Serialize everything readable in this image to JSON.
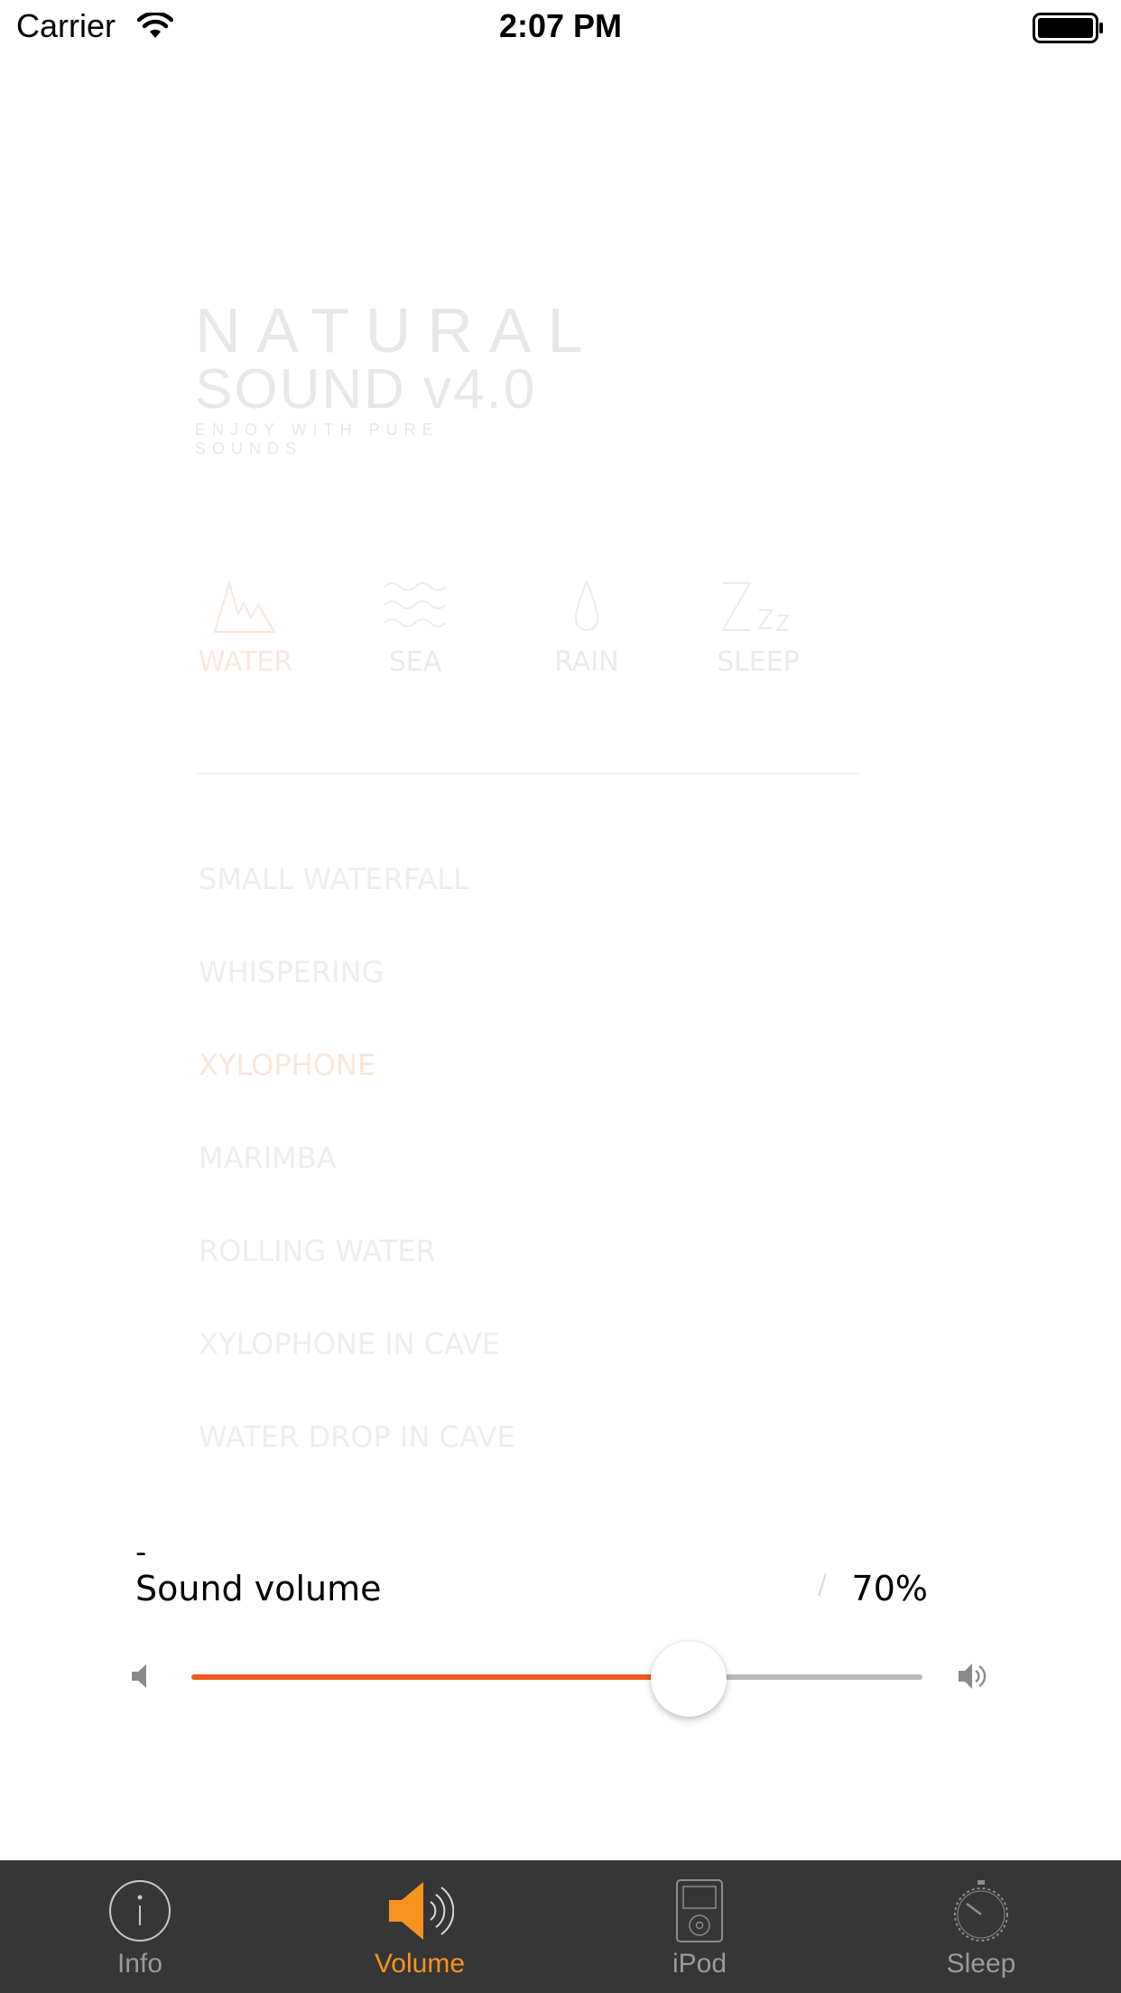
{
  "status_bar": {
    "carrier": "Carrier",
    "time": "2:07 PM"
  },
  "logo": {
    "line1": "NATURAL",
    "line2": "SOUND v4.0",
    "tagline": "ENJOY WITH PURE SOUNDS"
  },
  "categories": [
    {
      "label": "WATER",
      "icon": "mountain-icon",
      "active": true
    },
    {
      "label": "SEA",
      "icon": "waves-icon",
      "active": false
    },
    {
      "label": "RAIN",
      "icon": "raindrop-icon",
      "active": false
    },
    {
      "label": "SLEEP",
      "icon": "zzz-icon",
      "active": false
    }
  ],
  "tracks": [
    {
      "label": "SMALL WATERFALL"
    },
    {
      "label": "WHISPERING"
    },
    {
      "label": "XYLOPHONE",
      "active": true
    },
    {
      "label": "MARIMBA"
    },
    {
      "label": "ROLLING WATER"
    },
    {
      "label": "XYLOPHONE IN CAVE"
    },
    {
      "label": "WATER DROP IN CAVE"
    }
  ],
  "volume_panel": {
    "dash": "-",
    "label": "Sound volume",
    "value_text": "70%",
    "value_fraction": 0.68
  },
  "tab_bar": {
    "items": [
      {
        "label": "Info",
        "icon": "info-icon",
        "active": false
      },
      {
        "label": "Volume",
        "icon": "speaker-icon",
        "active": true
      },
      {
        "label": "iPod",
        "icon": "ipod-icon",
        "active": false
      },
      {
        "label": "Sleep",
        "icon": "stopwatch-icon",
        "active": false
      }
    ]
  },
  "colors": {
    "accent": "#f7931e",
    "slider_fill": "#ee5a1d",
    "tab_bar_bg": "#363636"
  }
}
